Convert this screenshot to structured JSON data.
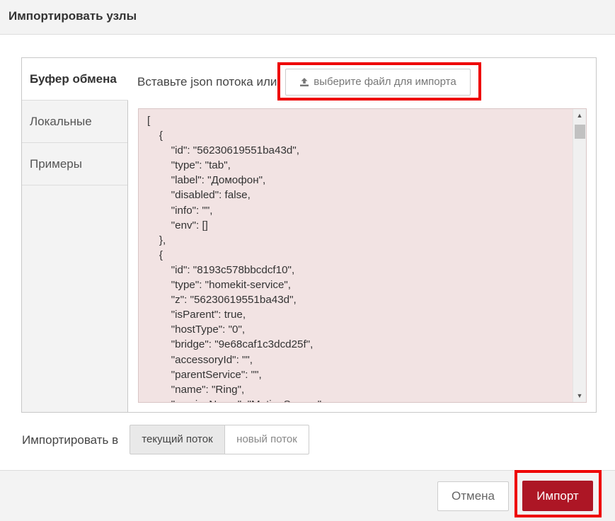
{
  "dialog": {
    "title": "Импортировать узлы"
  },
  "tabs": [
    {
      "label": "Буфер обмена"
    },
    {
      "label": "Локальные"
    },
    {
      "label": "Примеры"
    }
  ],
  "clipboard": {
    "paste_label": "Вставьте json потока или",
    "file_button_label": "выберите файл для импорта",
    "file_button_icon": "upload-icon",
    "json_text": "[\n    {\n        \"id\": \"56230619551ba43d\",\n        \"type\": \"tab\",\n        \"label\": \"Домофон\",\n        \"disabled\": false,\n        \"info\": \"\",\n        \"env\": []\n    },\n    {\n        \"id\": \"8193c578bbcdcf10\",\n        \"type\": \"homekit-service\",\n        \"z\": \"56230619551ba43d\",\n        \"isParent\": true,\n        \"hostType\": \"0\",\n        \"bridge\": \"9e68caf1c3dcd25f\",\n        \"accessoryId\": \"\",\n        \"parentService\": \"\",\n        \"name\": \"Ring\",\n        \"serviceName\": \"MotionSensor\","
  },
  "import_to": {
    "label": "Импортировать в",
    "options": [
      "текущий поток",
      "новый поток"
    ],
    "selected": "текущий поток"
  },
  "footer": {
    "cancel_label": "Отмена",
    "import_label": "Импорт"
  },
  "colors": {
    "primary_button": "#ad1625",
    "editor_background": "#f2e3e3",
    "highlight": "#ee0000"
  }
}
